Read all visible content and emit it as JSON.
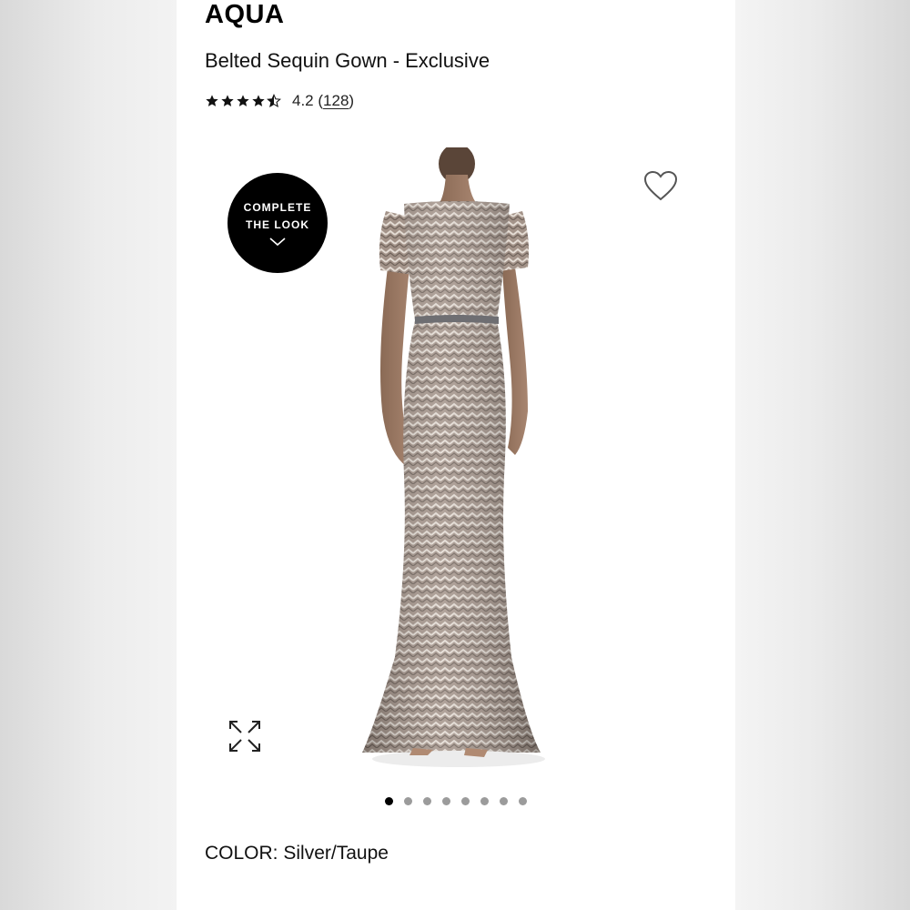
{
  "product": {
    "brand": "AQUA",
    "title": "Belted Sequin Gown - Exclusive",
    "rating_value": "4.2",
    "rating_stars": 4.5,
    "review_count": "128",
    "color_label": "COLOR:",
    "color_value": "Silver/Taupe"
  },
  "gallery": {
    "badge_line1": "COMPLETE",
    "badge_line2": "THE LOOK",
    "slide_count": 8,
    "active_slide": 1
  },
  "icons": {
    "wishlist": "heart-icon",
    "expand": "expand-icon",
    "badge_chevron": "chevron-down-icon",
    "star": "star-icon"
  },
  "colors": {
    "text": "#111111",
    "badge_bg": "#000000",
    "dot_active": "#000000",
    "dot_inactive": "#9b9b9b"
  }
}
